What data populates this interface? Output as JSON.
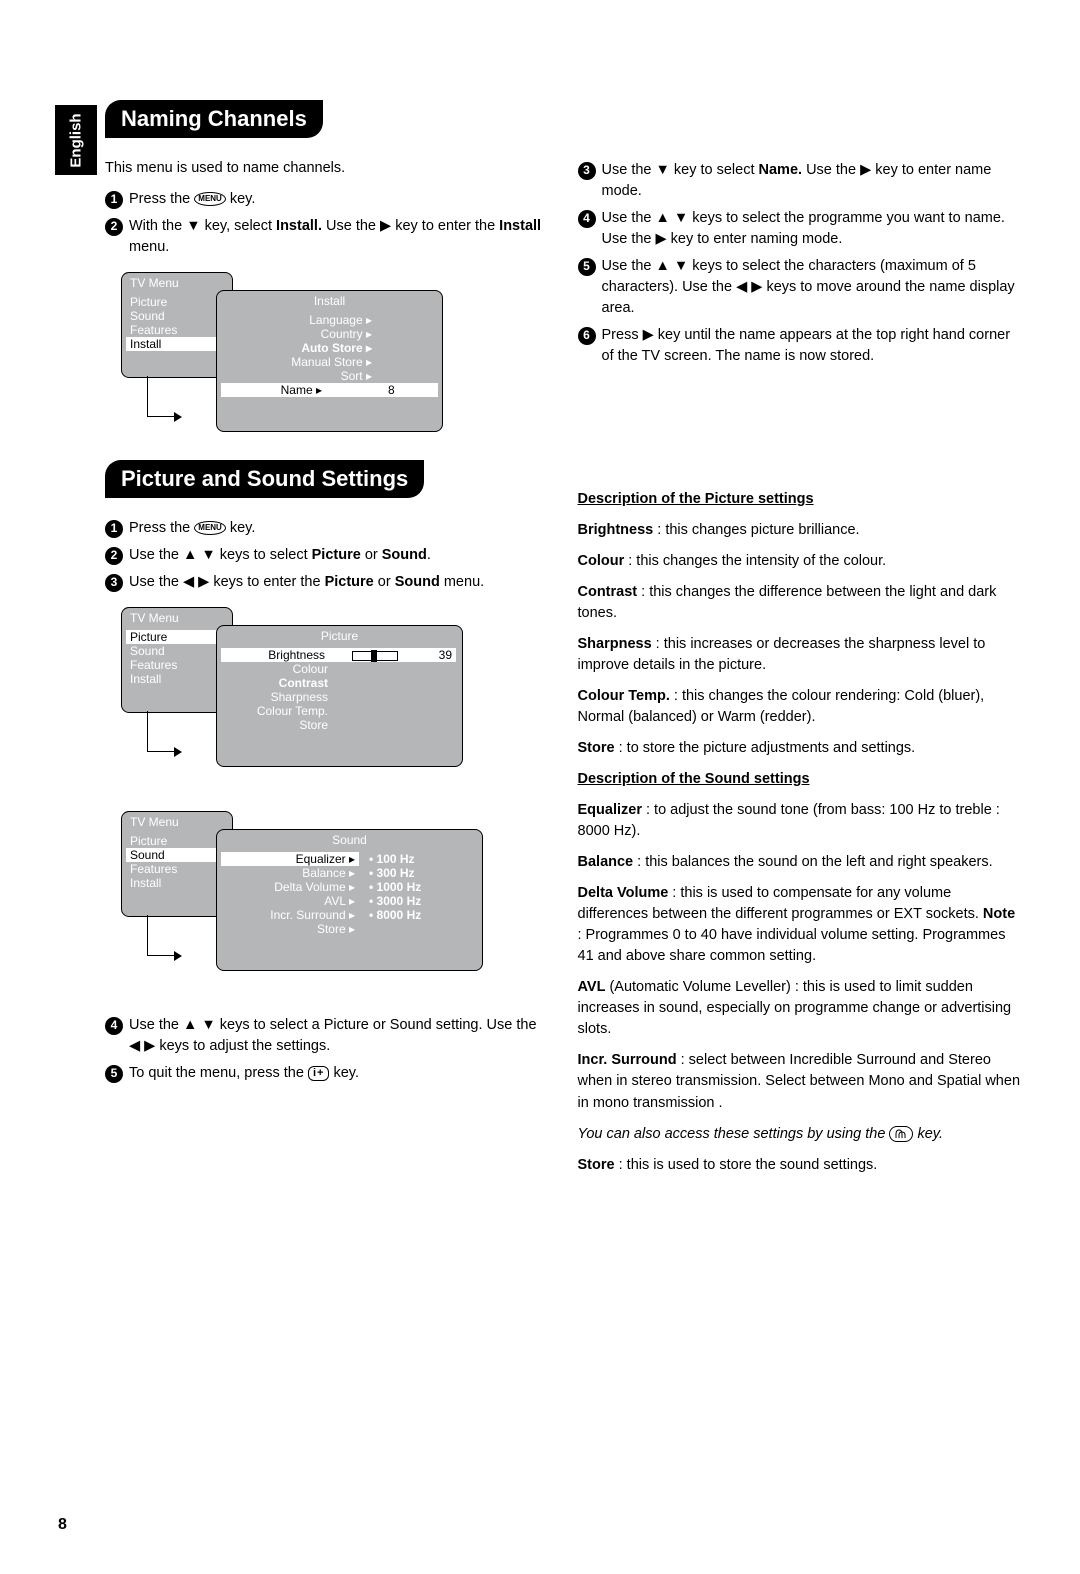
{
  "page_number": "8",
  "language_tab": "English",
  "headings": {
    "naming": "Naming Channels",
    "picsound": "Picture and Sound Settings",
    "desc_pic": "Description of the Picture settings",
    "desc_snd": "Description of the Sound settings"
  },
  "naming": {
    "intro": "This menu is used to name channels.",
    "step1_a": "Press the ",
    "step1_b": " key.",
    "step2_a": "With the ▼ key, select ",
    "step2_b": "Install.",
    "step2_c": " Use the ▶ key to enter the ",
    "step2_d": "Install",
    "step2_e": " menu.",
    "step3_a": "Use the ▼ key to select ",
    "step3_b": "Name.",
    "step3_c": " Use the ▶ key to enter name mode.",
    "step4": "Use the ▲ ▼ keys to select the programme you want to name. Use the ▶ key to enter naming mode.",
    "step5": "Use the ▲ ▼ keys to select the characters (maximum of 5 characters). Use the ◀  ▶ keys to move around the name display area.",
    "step6": "Press  ▶ key until the name appears at the top right hand corner of the TV screen. The name is now stored."
  },
  "diagram1": {
    "tvmenu": "TV Menu",
    "left_items": [
      "Picture",
      "Sound",
      "Features",
      "Install"
    ],
    "right_title": "Install",
    "right_items": [
      "Language ▸",
      "Country ▸",
      "Auto Store ▸",
      "Manual Store ▸",
      "Sort ▸",
      "Name  ▸"
    ],
    "value": "8"
  },
  "picsound": {
    "step1_a": "Press the ",
    "step1_b": " key.",
    "step2_a": "Use the ▲ ▼ keys to select ",
    "step2_b": "Picture",
    "step2_c": " or ",
    "step2_d": "Sound",
    "step2_e": ".",
    "step3_a": "Use the  ◀  ▶  keys to enter the ",
    "step3_b": "Picture",
    "step3_c": " or ",
    "step3_d": "Sound",
    "step3_e": " menu.",
    "step4": "Use the ▲ ▼ keys to select a Picture or Sound setting. Use the ◀  ▶ keys to adjust the settings.",
    "step5_a": "To quit the menu, press the  ",
    "step5_b": "  key."
  },
  "diagram2": {
    "tvmenu": "TV Menu",
    "left_items": [
      "Picture",
      "Sound",
      "Features",
      "Install"
    ],
    "right_title": "Picture",
    "right_items": [
      "Brightness",
      "Colour",
      "Contrast",
      "Sharpness",
      "Colour Temp.",
      "Store"
    ],
    "value": "39"
  },
  "diagram3": {
    "tvmenu": "TV Menu",
    "left_items": [
      "Picture",
      "Sound",
      "Features",
      "Install"
    ],
    "right_title": "Sound",
    "right_items": [
      "Equalizer  ▸",
      "Balance  ▸",
      "Delta Volume  ▸",
      "AVL  ▸",
      "Incr. Surround  ▸",
      "Store  ▸"
    ],
    "right_sub": [
      "•  100 Hz",
      "•  300 Hz",
      "•  1000 Hz",
      "•  3000 Hz",
      "•  8000 Hz"
    ]
  },
  "desc_picture": {
    "brightness": "Brightness",
    "brightness_t": " : this changes picture brilliance.",
    "colour": "Colour",
    "colour_t": " : this changes the intensity of the colour.",
    "contrast": "Contrast",
    "contrast_t": " : this changes the difference between the light and dark tones.",
    "sharpness": "Sharpness",
    "sharpness_t": " : this increases or decreases the sharpness level to improve details in the picture.",
    "ctemp": "Colour Temp.",
    "ctemp_t": " : this changes the colour rendering: Cold (bluer), Normal (balanced) or Warm (redder).",
    "store": "Store",
    "store_t": " : to store the picture adjustments and settings."
  },
  "desc_sound": {
    "eq": "Equalizer",
    "eq_t": " : to adjust the sound tone (from bass: 100 Hz to treble : 8000 Hz).",
    "bal": "Balance",
    "bal_t": " : this balances the sound on the left and right speakers.",
    "dv": "Delta Volume",
    "dv_t1": " : this is used to compensate for any volume differences between the different programmes or EXT sockets. ",
    "dv_note": "Note",
    "dv_t2": " : Programmes 0 to 40 have individual volume setting. Programmes 41 and above share common setting.",
    "avl": "AVL",
    "avl_t": " (Automatic Volume Leveller) : this is used to limit sudden increases in sound, especially on programme change or advertising slots.",
    "isur": "Incr. Surround",
    "isur_t": " : select between Incredible Surround and Stereo when in stereo transmission. Select between Mono and Spatial when in mono transmission .",
    "note_it_a": "You can also access these settings by using the ",
    "note_it_b": " key.",
    "store": "Store",
    "store_t": " : this is used to store the sound settings."
  },
  "keys": {
    "menu": "MENU",
    "iplus": "i+",
    "sound": "♫"
  }
}
